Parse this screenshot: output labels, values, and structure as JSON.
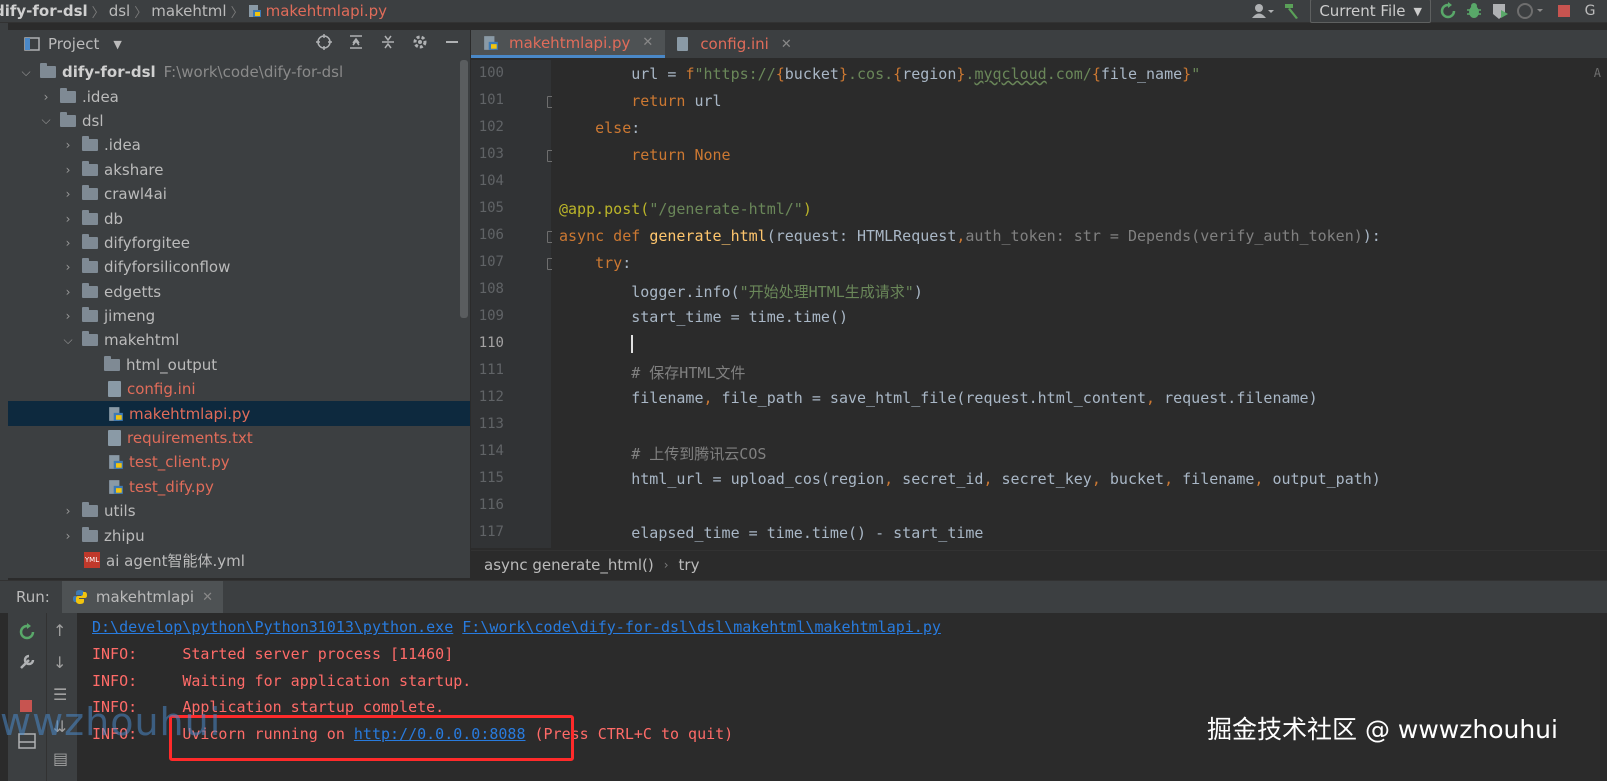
{
  "breadcrumbs": [
    "dify-for-dsl",
    "dsl",
    "makehtml",
    "makehtmlapi.py"
  ],
  "toolbar": {
    "run_config": "Current File",
    "icons": [
      "user-icon",
      "build-hammer-icon",
      "run-icon",
      "debug-icon",
      "coverage-icon",
      "profile-icon",
      "stop-icon"
    ]
  },
  "project": {
    "title": "Project",
    "root": {
      "name": "dify-for-dsl",
      "path": "F:\\work\\code\\dify-for-dsl"
    },
    "items": [
      {
        "label": "dify-for-dsl",
        "extra": "F:\\work\\code\\dify-for-dsl"
      },
      {
        "label": ".idea"
      },
      {
        "label": "dsl"
      },
      {
        "label": ".idea"
      },
      {
        "label": "akshare"
      },
      {
        "label": "crawl4ai"
      },
      {
        "label": "db"
      },
      {
        "label": "difyforgitee"
      },
      {
        "label": "difyforsiliconflow"
      },
      {
        "label": "edgetts"
      },
      {
        "label": "jimeng"
      },
      {
        "label": "makehtml"
      },
      {
        "label": "html_output"
      },
      {
        "label": "config.ini"
      },
      {
        "label": "makehtmlapi.py"
      },
      {
        "label": "requirements.txt"
      },
      {
        "label": "test_client.py"
      },
      {
        "label": "test_dify.py"
      },
      {
        "label": "utils"
      },
      {
        "label": "zhipu"
      },
      {
        "label": "ai agent智能体.yml"
      }
    ]
  },
  "editor": {
    "tabs": [
      {
        "label": "makehtmlapi.py"
      },
      {
        "label": "config.ini"
      }
    ],
    "line_numbers": [
      "100",
      "101",
      "102",
      "103",
      "104",
      "105",
      "106",
      "107",
      "108",
      "109",
      "110",
      "111",
      "112",
      "113",
      "114",
      "115",
      "116",
      "117"
    ],
    "lines": [
      "        url = f\"https://{bucket}.cos.{region}.myqcloud.com/{file_name}\"",
      "        return url",
      "    else:",
      "        return None",
      "",
      "@app.post(\"/generate-html/\")",
      "async def generate_html(request: HTMLRequest, auth_token: str = Depends(verify_auth_token)):",
      "    try:",
      "        logger.info(\"开始处理HTML生成请求\")",
      "        start_time = time.time()",
      "",
      "        # 保存HTML文件",
      "        filename, file_path = save_html_file(request.html_content, request.filename)",
      "",
      "        # 上传到腾讯云COS",
      "        html_url = upload_cos(region, secret_id, secret_key, bucket, filename, output_path)",
      "",
      "        elapsed_time = time.time() - start_time"
    ],
    "footer_crumbs": [
      "async generate_html()",
      "try"
    ]
  },
  "run": {
    "label": "Run:",
    "tab": "makehtmlapi",
    "console": [
      {
        "a": "D:\\develop\\python\\Python31013\\python.exe",
        "b": "F:\\work\\code\\dify-for-dsl\\dsl\\makehtml\\makehtmlapi.py"
      },
      {
        "level": "INFO:",
        "msg": "Started server process [11460]"
      },
      {
        "level": "INFO:",
        "msg": "Waiting for application startup."
      },
      {
        "level": "INFO:",
        "msg": "Application startup complete."
      },
      {
        "level": "INFO:",
        "msg_pre": "Uvicorn running on ",
        "url": "http://0.0.0.0:8088",
        "msg_post": " (Press CTRL+C to quit)"
      }
    ]
  },
  "watermarks": {
    "left": "wwzhouhui",
    "right": "掘金技术社区 @ wwwzhouhui"
  },
  "colors": {
    "accent": "#4a88c7",
    "error_red": "#ff6b68",
    "link": "#287bde",
    "highlight_box": "#ff2a2a"
  }
}
